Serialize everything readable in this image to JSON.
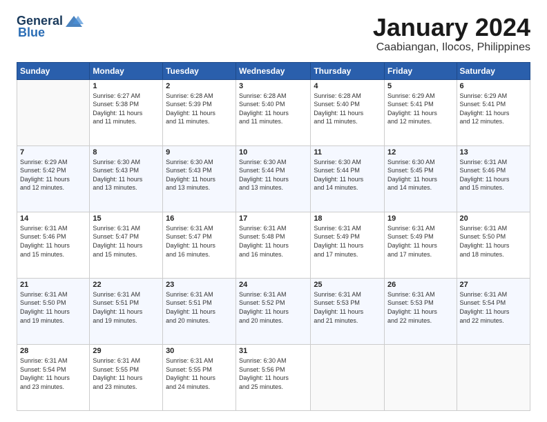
{
  "logo": {
    "text_general": "General",
    "text_blue": "Blue"
  },
  "title": "January 2024",
  "location": "Caabiangan, Ilocos, Philippines",
  "days_header": [
    "Sunday",
    "Monday",
    "Tuesday",
    "Wednesday",
    "Thursday",
    "Friday",
    "Saturday"
  ],
  "weeks": [
    [
      {
        "num": "",
        "content": ""
      },
      {
        "num": "1",
        "content": "Sunrise: 6:27 AM\nSunset: 5:38 PM\nDaylight: 11 hours\nand 11 minutes."
      },
      {
        "num": "2",
        "content": "Sunrise: 6:28 AM\nSunset: 5:39 PM\nDaylight: 11 hours\nand 11 minutes."
      },
      {
        "num": "3",
        "content": "Sunrise: 6:28 AM\nSunset: 5:40 PM\nDaylight: 11 hours\nand 11 minutes."
      },
      {
        "num": "4",
        "content": "Sunrise: 6:28 AM\nSunset: 5:40 PM\nDaylight: 11 hours\nand 11 minutes."
      },
      {
        "num": "5",
        "content": "Sunrise: 6:29 AM\nSunset: 5:41 PM\nDaylight: 11 hours\nand 12 minutes."
      },
      {
        "num": "6",
        "content": "Sunrise: 6:29 AM\nSunset: 5:41 PM\nDaylight: 11 hours\nand 12 minutes."
      }
    ],
    [
      {
        "num": "7",
        "content": "Sunrise: 6:29 AM\nSunset: 5:42 PM\nDaylight: 11 hours\nand 12 minutes."
      },
      {
        "num": "8",
        "content": "Sunrise: 6:30 AM\nSunset: 5:43 PM\nDaylight: 11 hours\nand 13 minutes."
      },
      {
        "num": "9",
        "content": "Sunrise: 6:30 AM\nSunset: 5:43 PM\nDaylight: 11 hours\nand 13 minutes."
      },
      {
        "num": "10",
        "content": "Sunrise: 6:30 AM\nSunset: 5:44 PM\nDaylight: 11 hours\nand 13 minutes."
      },
      {
        "num": "11",
        "content": "Sunrise: 6:30 AM\nSunset: 5:44 PM\nDaylight: 11 hours\nand 14 minutes."
      },
      {
        "num": "12",
        "content": "Sunrise: 6:30 AM\nSunset: 5:45 PM\nDaylight: 11 hours\nand 14 minutes."
      },
      {
        "num": "13",
        "content": "Sunrise: 6:31 AM\nSunset: 5:46 PM\nDaylight: 11 hours\nand 15 minutes."
      }
    ],
    [
      {
        "num": "14",
        "content": "Sunrise: 6:31 AM\nSunset: 5:46 PM\nDaylight: 11 hours\nand 15 minutes."
      },
      {
        "num": "15",
        "content": "Sunrise: 6:31 AM\nSunset: 5:47 PM\nDaylight: 11 hours\nand 15 minutes."
      },
      {
        "num": "16",
        "content": "Sunrise: 6:31 AM\nSunset: 5:47 PM\nDaylight: 11 hours\nand 16 minutes."
      },
      {
        "num": "17",
        "content": "Sunrise: 6:31 AM\nSunset: 5:48 PM\nDaylight: 11 hours\nand 16 minutes."
      },
      {
        "num": "18",
        "content": "Sunrise: 6:31 AM\nSunset: 5:49 PM\nDaylight: 11 hours\nand 17 minutes."
      },
      {
        "num": "19",
        "content": "Sunrise: 6:31 AM\nSunset: 5:49 PM\nDaylight: 11 hours\nand 17 minutes."
      },
      {
        "num": "20",
        "content": "Sunrise: 6:31 AM\nSunset: 5:50 PM\nDaylight: 11 hours\nand 18 minutes."
      }
    ],
    [
      {
        "num": "21",
        "content": "Sunrise: 6:31 AM\nSunset: 5:50 PM\nDaylight: 11 hours\nand 19 minutes."
      },
      {
        "num": "22",
        "content": "Sunrise: 6:31 AM\nSunset: 5:51 PM\nDaylight: 11 hours\nand 19 minutes."
      },
      {
        "num": "23",
        "content": "Sunrise: 6:31 AM\nSunset: 5:51 PM\nDaylight: 11 hours\nand 20 minutes."
      },
      {
        "num": "24",
        "content": "Sunrise: 6:31 AM\nSunset: 5:52 PM\nDaylight: 11 hours\nand 20 minutes."
      },
      {
        "num": "25",
        "content": "Sunrise: 6:31 AM\nSunset: 5:53 PM\nDaylight: 11 hours\nand 21 minutes."
      },
      {
        "num": "26",
        "content": "Sunrise: 6:31 AM\nSunset: 5:53 PM\nDaylight: 11 hours\nand 22 minutes."
      },
      {
        "num": "27",
        "content": "Sunrise: 6:31 AM\nSunset: 5:54 PM\nDaylight: 11 hours\nand 22 minutes."
      }
    ],
    [
      {
        "num": "28",
        "content": "Sunrise: 6:31 AM\nSunset: 5:54 PM\nDaylight: 11 hours\nand 23 minutes."
      },
      {
        "num": "29",
        "content": "Sunrise: 6:31 AM\nSunset: 5:55 PM\nDaylight: 11 hours\nand 23 minutes."
      },
      {
        "num": "30",
        "content": "Sunrise: 6:31 AM\nSunset: 5:55 PM\nDaylight: 11 hours\nand 24 minutes."
      },
      {
        "num": "31",
        "content": "Sunrise: 6:30 AM\nSunset: 5:56 PM\nDaylight: 11 hours\nand 25 minutes."
      },
      {
        "num": "",
        "content": ""
      },
      {
        "num": "",
        "content": ""
      },
      {
        "num": "",
        "content": ""
      }
    ]
  ]
}
